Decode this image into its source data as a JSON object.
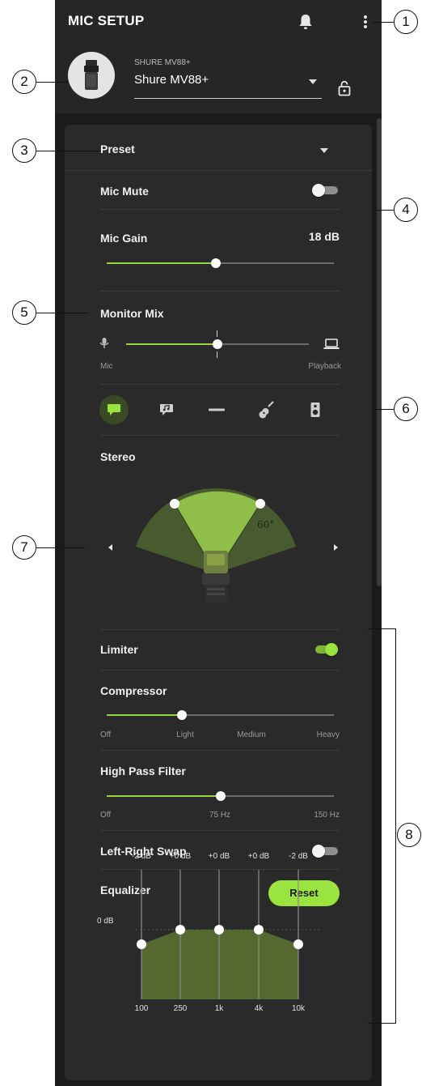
{
  "app": {
    "title": "MIC SETUP"
  },
  "icons": {
    "notifications": "bell-icon",
    "menu": "more-vert-icon",
    "lock": "lock-icon"
  },
  "device": {
    "model_label": "SHURE MV88+",
    "name": "Shure MV88+"
  },
  "preset": {
    "label": "Preset"
  },
  "mic_mute": {
    "label": "Mic Mute",
    "on": false
  },
  "mic_gain": {
    "label": "Mic Gain",
    "value": "18 dB",
    "level": 0.48
  },
  "monitor_mix": {
    "label": "Monitor Mix",
    "left_label": "Mic",
    "right_label": "Playback",
    "level": 0.5
  },
  "modes": [
    "speech-bubble-icon",
    "music-note-bubble-icon",
    "flat-icon",
    "guitar-icon",
    "speaker-icon"
  ],
  "stereo": {
    "label": "Stereo",
    "angle_label": "60°"
  },
  "limiter": {
    "label": "Limiter",
    "on": true
  },
  "compressor": {
    "label": "Compressor",
    "ticks": [
      "Off",
      "Light",
      "Medium",
      "Heavy"
    ],
    "level": 0.33
  },
  "high_pass": {
    "label": "High Pass Filter",
    "ticks": [
      "Off",
      "75 Hz",
      "150 Hz"
    ],
    "level": 0.5
  },
  "lr_swap": {
    "label": "Left-Right Swap",
    "on": false
  },
  "equalizer": {
    "label": "Equalizer",
    "reset_label": "Reset",
    "zero_label": "0 dB",
    "bands": [
      {
        "freq": "100",
        "gain_label": "-2 dB",
        "gain": -2
      },
      {
        "freq": "250",
        "gain_label": "+0 dB",
        "gain": 0
      },
      {
        "freq": "1k",
        "gain_label": "+0 dB",
        "gain": 0
      },
      {
        "freq": "4k",
        "gain_label": "+0 dB",
        "gain": 0
      },
      {
        "freq": "10k",
        "gain_label": "-2 dB",
        "gain": -2
      }
    ]
  },
  "colors": {
    "accent": "#9be33e",
    "panel": "#2a2a2a",
    "background": "#1b1b1b"
  },
  "callouts": [
    "1",
    "2",
    "3",
    "4",
    "5",
    "6",
    "7",
    "8"
  ]
}
